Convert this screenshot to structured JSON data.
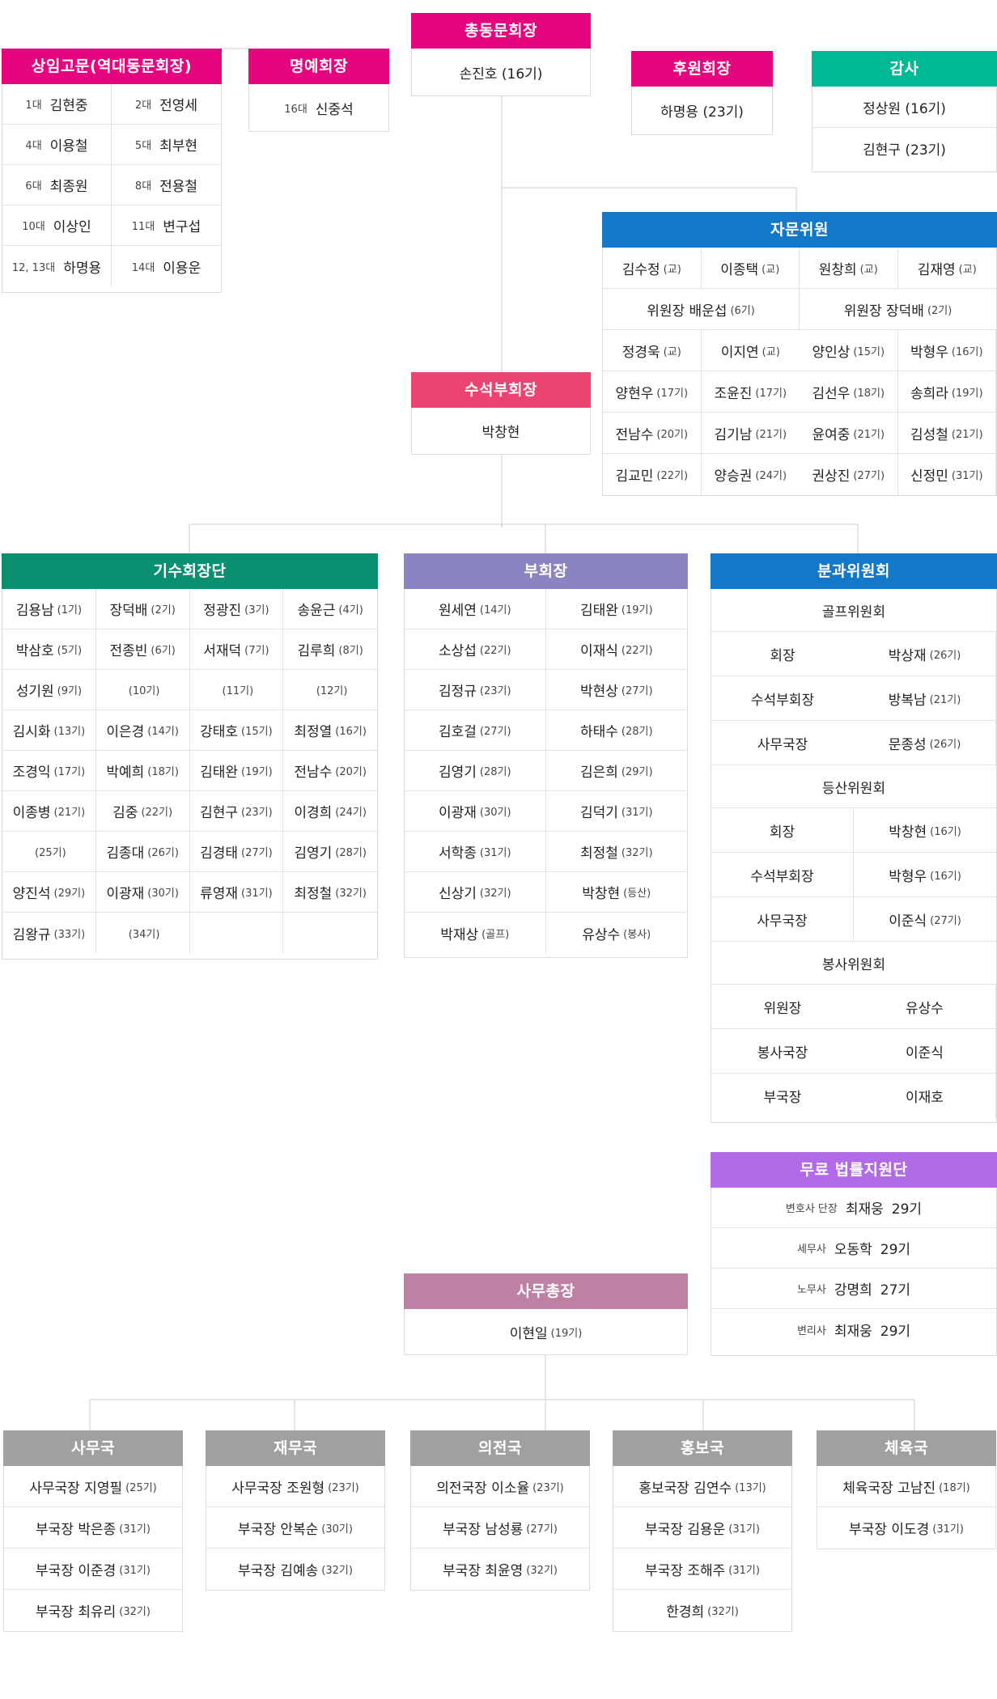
{
  "colors": {
    "pink": "#e4057f",
    "green": "#00b894",
    "blue": "#1478c8",
    "rose": "#ec4470",
    "teal": "#0a8f70",
    "purple": "#8a84c0",
    "violet": "#b36ae8",
    "mauve": "#be81a4",
    "gray": "#a0a0a0",
    "line": "#dddddd"
  },
  "president": {
    "title": "총동문회장",
    "name": "손진호 (16기)"
  },
  "advisors": {
    "title": "상임고문(역대동문회장)",
    "rows": [
      [
        "1대",
        "김현중",
        "2대",
        "전영세"
      ],
      [
        "4대",
        "이용철",
        "5대",
        "최부현"
      ],
      [
        "6대",
        "최종원",
        "8대",
        "전용철"
      ],
      [
        "10대",
        "이상인",
        "11대",
        "변구섭"
      ],
      [
        "12, 13대",
        "하명용",
        "14대",
        "이용운"
      ]
    ]
  },
  "honorary": {
    "title": "명예회장",
    "gen": "16대",
    "name": "신중석"
  },
  "sponsor": {
    "title": "후원회장",
    "name": "하명용 (23기)"
  },
  "auditor": {
    "title": "감사",
    "names": [
      "정상원 (16기)",
      "김현구 (23기)"
    ]
  },
  "consult": {
    "title": "자문위원",
    "row1": [
      [
        "김수정",
        "(교)"
      ],
      [
        "이종택",
        "(교)"
      ],
      [
        "원창희",
        "(교)"
      ],
      [
        "김재영",
        "(교)"
      ]
    ],
    "chairs": [
      [
        "위원장 배운섭",
        "(6기)"
      ],
      [
        "위원장 장덕배",
        "(2기)"
      ]
    ],
    "rows": [
      [
        [
          "정경욱",
          "(교)"
        ],
        [
          "이지연",
          "(교)"
        ],
        [
          "양인상",
          "(15기)"
        ],
        [
          "박형우",
          "(16기)"
        ]
      ],
      [
        [
          "양현우",
          "(17기)"
        ],
        [
          "조윤진",
          "(17기)"
        ],
        [
          "김선우",
          "(18기)"
        ],
        [
          "송희라",
          "(19기)"
        ]
      ],
      [
        [
          "전남수",
          "(20기)"
        ],
        [
          "김기남",
          "(21기)"
        ],
        [
          "윤여중",
          "(21기)"
        ],
        [
          "김성철",
          "(21기)"
        ]
      ],
      [
        [
          "김교민",
          "(22기)"
        ],
        [
          "양승권",
          "(24기)"
        ],
        [
          "권상진",
          "(27기)"
        ],
        [
          "신정민",
          "(31기)"
        ]
      ]
    ]
  },
  "senior_vp": {
    "title": "수석부회장",
    "name": "박창현"
  },
  "class_presidents": {
    "title": "기수회장단",
    "cells": [
      [
        "김용남",
        "(1기)"
      ],
      [
        "장덕배",
        "(2기)"
      ],
      [
        "정광진",
        "(3기)"
      ],
      [
        "송윤근",
        "(4기)"
      ],
      [
        "박삼호",
        "(5기)"
      ],
      [
        "전종빈",
        "(6기)"
      ],
      [
        "서재덕",
        "(7기)"
      ],
      [
        "김루희",
        "(8기)"
      ],
      [
        "성기원",
        "(9기)"
      ],
      [
        "",
        "(10기)"
      ],
      [
        "",
        "(11기)"
      ],
      [
        "",
        "(12기)"
      ],
      [
        "김시화",
        "(13기)"
      ],
      [
        "이은경",
        "(14기)"
      ],
      [
        "강태호",
        "(15기)"
      ],
      [
        "최정열",
        "(16기)"
      ],
      [
        "조경익",
        "(17기)"
      ],
      [
        "박예희",
        "(18기)"
      ],
      [
        "김태완",
        "(19기)"
      ],
      [
        "전남수",
        "(20기)"
      ],
      [
        "이종병",
        "(21기)"
      ],
      [
        "김중",
        "(22기)"
      ],
      [
        "김현구",
        "(23기)"
      ],
      [
        "이경희",
        "(24기)"
      ],
      [
        "",
        "(25기)"
      ],
      [
        "김종대",
        "(26기)"
      ],
      [
        "김경태",
        "(27기)"
      ],
      [
        "김영기",
        "(28기)"
      ],
      [
        "양진석",
        "(29기)"
      ],
      [
        "이광재",
        "(30기)"
      ],
      [
        "류영재",
        "(31기)"
      ],
      [
        "최정철",
        "(32기)"
      ],
      [
        "김왕규",
        "(33기)"
      ],
      [
        "",
        "(34기)"
      ],
      [
        "",
        ""
      ],
      [
        "",
        ""
      ]
    ]
  },
  "vice_presidents": {
    "title": "부회장",
    "cells": [
      [
        "원세연",
        "(14기)"
      ],
      [
        "김태완",
        "(19기)"
      ],
      [
        "소상섭",
        "(22기)"
      ],
      [
        "이재식",
        "(22기)"
      ],
      [
        "김정규",
        "(23기)"
      ],
      [
        "박현상",
        "(27기)"
      ],
      [
        "김호걸",
        "(27기)"
      ],
      [
        "하태수",
        "(28기)"
      ],
      [
        "김영기",
        "(28기)"
      ],
      [
        "김은희",
        "(29기)"
      ],
      [
        "이광재",
        "(30기)"
      ],
      [
        "김덕기",
        "(31기)"
      ],
      [
        "서학종",
        "(31기)"
      ],
      [
        "최정철",
        "(32기)"
      ],
      [
        "신상기",
        "(32기)"
      ],
      [
        "박창현",
        "(등산)"
      ],
      [
        "박재상",
        "(골프)"
      ],
      [
        "유상수",
        "(봉사)"
      ]
    ]
  },
  "committees": {
    "title": "분과위원회",
    "sections": [
      {
        "name": "골프위원회",
        "rows": [
          [
            "회장",
            "박상재",
            "(26기)"
          ],
          [
            "수석부회장",
            "방복남",
            "(21기)"
          ],
          [
            "사무국장",
            "문종성",
            "(26기)"
          ]
        ]
      },
      {
        "name": "등산위원회",
        "rows": [
          [
            "회장",
            "박창현",
            "(16기)"
          ],
          [
            "수석부회장",
            "박형우",
            "(16기)"
          ],
          [
            "사무국장",
            "이준식",
            "(27기)"
          ]
        ]
      },
      {
        "name": "봉사위원회",
        "rows": [
          [
            "위원장",
            "유상수",
            ""
          ],
          [
            "봉사국장",
            "이준식",
            ""
          ],
          [
            "부국장",
            "이재호",
            ""
          ]
        ]
      }
    ]
  },
  "legal": {
    "title": "무료 법률지원단",
    "rows": [
      [
        "변호사 단장",
        "최재웅",
        "29기"
      ],
      [
        "세무사",
        "오동학",
        "29기"
      ],
      [
        "노무사",
        "강명희",
        "27기"
      ],
      [
        "변리사",
        "최재웅",
        "29기"
      ]
    ]
  },
  "secretary_general": {
    "title": "사무총장",
    "name": "이현일",
    "gen": "(19기)"
  },
  "bureaus": [
    {
      "title": "사무국",
      "rows": [
        [
          "사무국장 지영필",
          "(25기)"
        ],
        [
          "부국장 박은종",
          "(31기)"
        ],
        [
          "부국장 이준경",
          "(31기)"
        ],
        [
          "부국장 최유리",
          "(32기)"
        ]
      ]
    },
    {
      "title": "재무국",
      "rows": [
        [
          "사무국장 조원형",
          "(23기)"
        ],
        [
          "부국장 안복순",
          "(30기)"
        ],
        [
          "부국장 김예송",
          "(32기)"
        ]
      ]
    },
    {
      "title": "의전국",
      "rows": [
        [
          "의전국장 이소율",
          "(23기)"
        ],
        [
          "부국장 남성룡",
          "(27기)"
        ],
        [
          "부국장 최윤영",
          "(32기)"
        ]
      ]
    },
    {
      "title": "홍보국",
      "rows": [
        [
          "홍보국장 김연수",
          "(13기)"
        ],
        [
          "부국장 김용운",
          "(31기)"
        ],
        [
          "부국장 조해주",
          "(31기)"
        ],
        [
          "한경희",
          "(32기)"
        ]
      ]
    },
    {
      "title": "체육국",
      "rows": [
        [
          "체육국장 고남진",
          "(18기)"
        ],
        [
          "부국장 이도경",
          "(31기)"
        ]
      ]
    }
  ]
}
